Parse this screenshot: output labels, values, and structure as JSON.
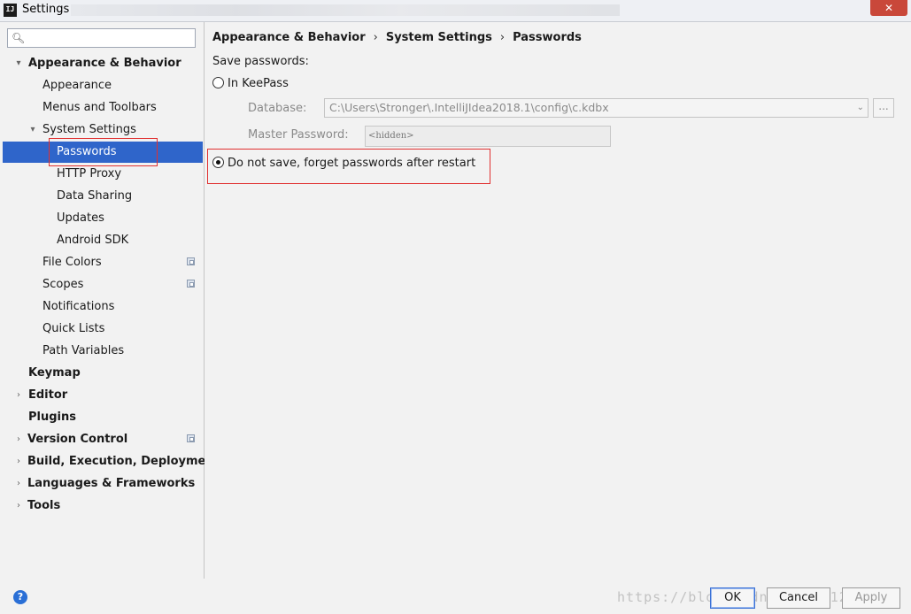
{
  "window": {
    "title": "Settings",
    "app_icon": "IJ",
    "close_glyph": "✕"
  },
  "sidebar": {
    "search_placeholder": "",
    "items": [
      {
        "label": "Appearance & Behavior",
        "expand": "▾"
      },
      {
        "label": "Appearance"
      },
      {
        "label": "Menus and Toolbars"
      },
      {
        "label": "System Settings",
        "expand": "▾"
      },
      {
        "label": "Passwords"
      },
      {
        "label": "HTTP Proxy"
      },
      {
        "label": "Data Sharing"
      },
      {
        "label": "Updates"
      },
      {
        "label": "Android SDK"
      },
      {
        "label": "File Colors"
      },
      {
        "label": "Scopes"
      },
      {
        "label": "Notifications"
      },
      {
        "label": "Quick Lists"
      },
      {
        "label": "Path Variables"
      },
      {
        "label": "Keymap"
      },
      {
        "label": "Editor",
        "expand": "›"
      },
      {
        "label": "Plugins"
      },
      {
        "label": "Version Control",
        "expand": "›"
      },
      {
        "label": "Build, Execution, Deployment",
        "expand": "›"
      },
      {
        "label": "Languages & Frameworks",
        "expand": "›"
      },
      {
        "label": "Tools",
        "expand": "›"
      }
    ]
  },
  "main": {
    "breadcrumb": [
      "Appearance & Behavior",
      "System Settings",
      "Passwords"
    ],
    "breadcrumb_sep": "›",
    "section_label": "Save passwords:",
    "option_keepass": "In KeePass",
    "database_label": "Database:",
    "database_value": "C:\\Users\\Stronger\\.IntelliJIdea2018.1\\config\\c.kdbx",
    "browse_label": "...",
    "master_password_label": "Master Password:",
    "master_password_value": "<hidden>",
    "option_do_not_save": "Do not save, forget passwords after restart",
    "selected_option": "do_not_save"
  },
  "footer": {
    "help": "?",
    "ok": "OK",
    "cancel": "Cancel",
    "apply": "Apply",
    "watermark": "https://blog.csdn.net/u012687358"
  },
  "colors": {
    "selection": "#2f65ca",
    "highlight": "#e03030"
  }
}
